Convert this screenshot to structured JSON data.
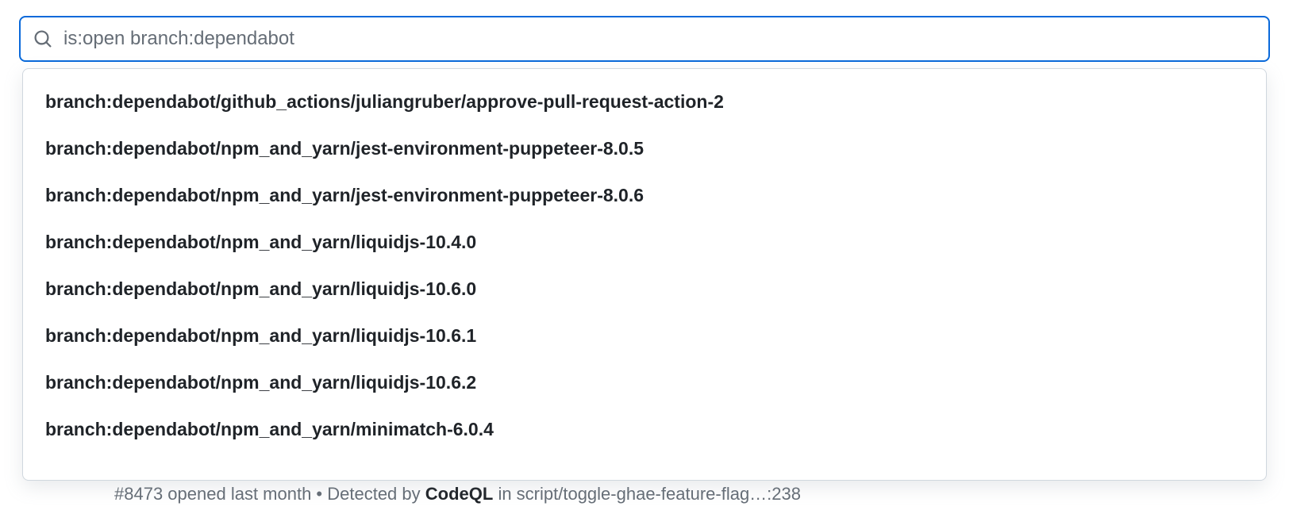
{
  "search": {
    "value": "is:open branch:dependabot",
    "placeholder": ""
  },
  "suggestions": [
    "branch:dependabot/github_actions/juliangruber/approve-pull-request-action-2",
    "branch:dependabot/npm_and_yarn/jest-environment-puppeteer-8.0.5",
    "branch:dependabot/npm_and_yarn/jest-environment-puppeteer-8.0.6",
    "branch:dependabot/npm_and_yarn/liquidjs-10.4.0",
    "branch:dependabot/npm_and_yarn/liquidjs-10.6.0",
    "branch:dependabot/npm_and_yarn/liquidjs-10.6.1",
    "branch:dependabot/npm_and_yarn/liquidjs-10.6.2",
    "branch:dependabot/npm_and_yarn/minimatch-6.0.4"
  ],
  "underlying": {
    "issue_number": "#8473",
    "opened_text": " opened last month • Detected by ",
    "detector": "CodeQL",
    "in_text": " in script/toggle-ghae-feature-flag…:238"
  }
}
